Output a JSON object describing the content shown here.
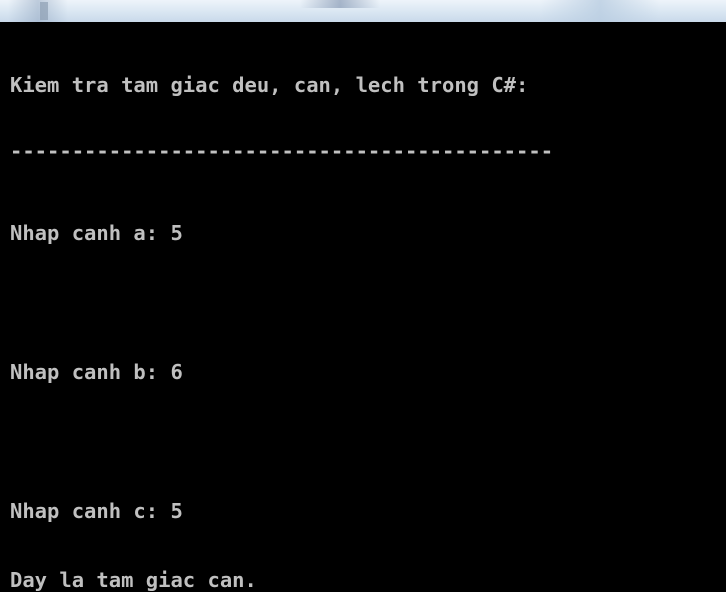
{
  "window": {
    "background_color": "#000000",
    "text_color": "#c0c0c0"
  },
  "console": {
    "title": "Kiem tra tam giac deu, can, lech trong C#:",
    "separator": "--------------------------------------------",
    "prompt_a": "Nhap canh a: 5",
    "prompt_b": "Nhap canh b: 6",
    "prompt_c": "Nhap canh c: 5",
    "result": "Day la tam giac can."
  }
}
